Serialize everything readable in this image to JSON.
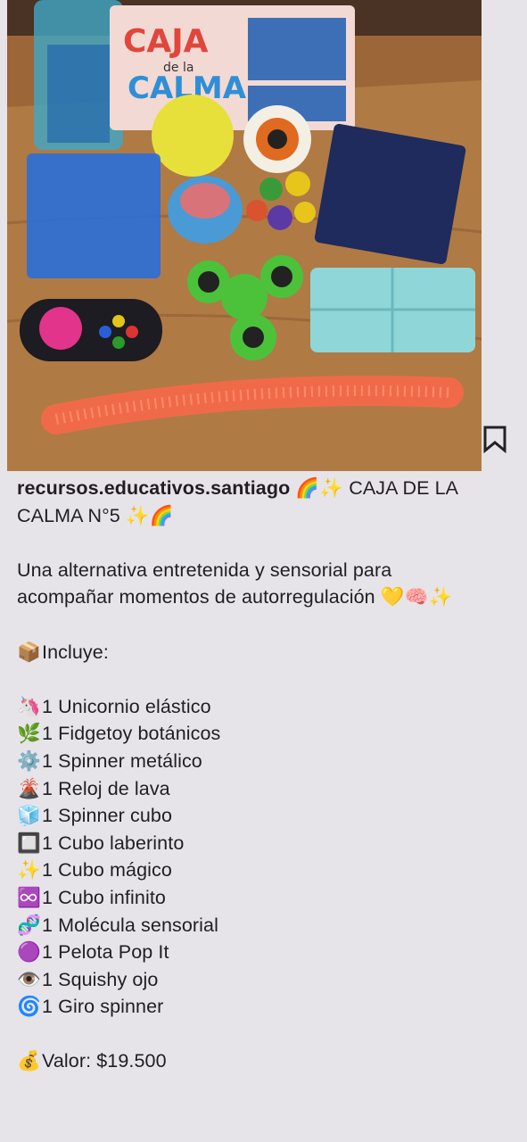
{
  "post": {
    "username": "recursos.educativos.santiago",
    "title_line1": "🌈✨ CAJA DE LA",
    "title_line2": "CALMA N°5 ✨🌈",
    "desc_line1": "Una alternativa entretenida y sensorial para",
    "desc_line2": "acompañar momentos de autorregulación 💛🧠✨",
    "includes_emoji": "📦",
    "includes_label": "Incluye:",
    "items": [
      {
        "emoji": "🦄",
        "text": "1 Unicornio elástico"
      },
      {
        "emoji": "🌿",
        "text": "1 Fidgetoy botánicos"
      },
      {
        "emoji": "⚙️",
        "text": "1 Spinner metálico"
      },
      {
        "emoji": "🌋",
        "text": "1 Reloj de lava"
      },
      {
        "emoji": "🧊",
        "text": "1 Spinner cubo"
      },
      {
        "emoji": "🔲",
        "text": "1 Cubo laberinto"
      },
      {
        "emoji": "✨",
        "text": "1 Cubo mágico"
      },
      {
        "emoji": "♾️",
        "text": "1 Cubo infinito"
      },
      {
        "emoji": "🧬",
        "text": "1 Molécula sensorial"
      },
      {
        "emoji": "🟣",
        "text": "1 Pelota Pop It"
      },
      {
        "emoji": "👁️",
        "text": "1 Squishy ojo"
      },
      {
        "emoji": "🌀",
        "text": "1 Giro spinner"
      }
    ],
    "price_emoji": "💰",
    "price_text": "Valor: $19.500",
    "box_title_1": "CAJA",
    "box_title_2": "de la",
    "box_title_3": "CALMA"
  },
  "icons": {
    "save": "bookmark-icon"
  },
  "colors": {
    "background": "#e6e4e9",
    "text": "#1f1f22"
  }
}
